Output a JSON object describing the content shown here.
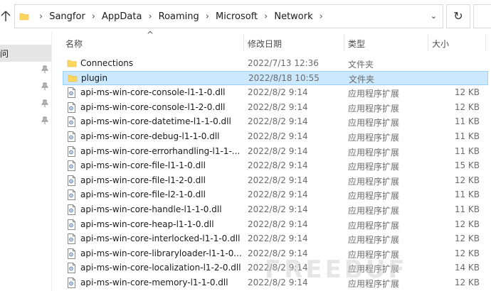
{
  "address_bar": {
    "crumbs": [
      "Sangfor",
      "AppData",
      "Roaming",
      "Microsoft",
      "Network"
    ]
  },
  "nav": {
    "selected_label": "问"
  },
  "columns": {
    "name": "名称",
    "date": "修改日期",
    "type": "类型",
    "size": "大小"
  },
  "files": [
    {
      "name": "Connections",
      "date": "2022/7/13 12:36",
      "type": "文件夹",
      "size": "",
      "kind": "folder"
    },
    {
      "name": "plugin",
      "date": "2022/8/18 10:55",
      "type": "文件夹",
      "size": "",
      "kind": "folder"
    },
    {
      "name": "api-ms-win-core-console-l1-1-0.dll",
      "date": "2022/8/2 9:14",
      "type": "应用程序扩展",
      "size": "12 KB",
      "kind": "dll"
    },
    {
      "name": "api-ms-win-core-console-l1-2-0.dll",
      "date": "2022/8/2 9:14",
      "type": "应用程序扩展",
      "size": "12 KB",
      "kind": "dll"
    },
    {
      "name": "api-ms-win-core-datetime-l1-1-0.dll",
      "date": "2022/8/2 9:14",
      "type": "应用程序扩展",
      "size": "11 KB",
      "kind": "dll"
    },
    {
      "name": "api-ms-win-core-debug-l1-1-0.dll",
      "date": "2022/8/2 9:14",
      "type": "应用程序扩展",
      "size": "11 KB",
      "kind": "dll"
    },
    {
      "name": "api-ms-win-core-errorhandling-l1-1-...",
      "date": "2022/8/2 9:14",
      "type": "应用程序扩展",
      "size": "11 KB",
      "kind": "dll"
    },
    {
      "name": "api-ms-win-core-file-l1-1-0.dll",
      "date": "2022/8/2 9:14",
      "type": "应用程序扩展",
      "size": "15 KB",
      "kind": "dll"
    },
    {
      "name": "api-ms-win-core-file-l1-2-0.dll",
      "date": "2022/8/2 9:14",
      "type": "应用程序扩展",
      "size": "12 KB",
      "kind": "dll"
    },
    {
      "name": "api-ms-win-core-file-l2-1-0.dll",
      "date": "2022/8/2 9:14",
      "type": "应用程序扩展",
      "size": "11 KB",
      "kind": "dll"
    },
    {
      "name": "api-ms-win-core-handle-l1-1-0.dll",
      "date": "2022/8/2 9:14",
      "type": "应用程序扩展",
      "size": "11 KB",
      "kind": "dll"
    },
    {
      "name": "api-ms-win-core-heap-l1-1-0.dll",
      "date": "2022/8/2 9:14",
      "type": "应用程序扩展",
      "size": "12 KB",
      "kind": "dll"
    },
    {
      "name": "api-ms-win-core-interlocked-l1-1-0.dll",
      "date": "2022/8/2 9:14",
      "type": "应用程序扩展",
      "size": "12 KB",
      "kind": "dll"
    },
    {
      "name": "api-ms-win-core-libraryloader-l1-1-0...",
      "date": "2022/8/2 9:14",
      "type": "应用程序扩展",
      "size": "12 KB",
      "kind": "dll"
    },
    {
      "name": "api-ms-win-core-localization-l1-2-0.dll",
      "date": "2022/8/2 9:14",
      "type": "应用程序扩展",
      "size": "14 KB",
      "kind": "dll"
    },
    {
      "name": "api-ms-win-core-memory-l1-1-0.dll",
      "date": "2022/8/2 9:14",
      "type": "应用程序扩展",
      "size": "12 KB",
      "kind": "dll"
    }
  ],
  "selected_index": 1,
  "watermark": "FREEBUF",
  "colors": {
    "selection_bg": "#cce8ff",
    "selection_border": "#99d1ff",
    "folder_yellow": "#ffd65c",
    "muted_text": "#6b6b6b"
  },
  "icons": {
    "up": "up-arrow-icon",
    "refresh": "refresh-icon",
    "folder": "folder-icon",
    "dll": "dll-file-icon",
    "pin": "pin-icon"
  }
}
